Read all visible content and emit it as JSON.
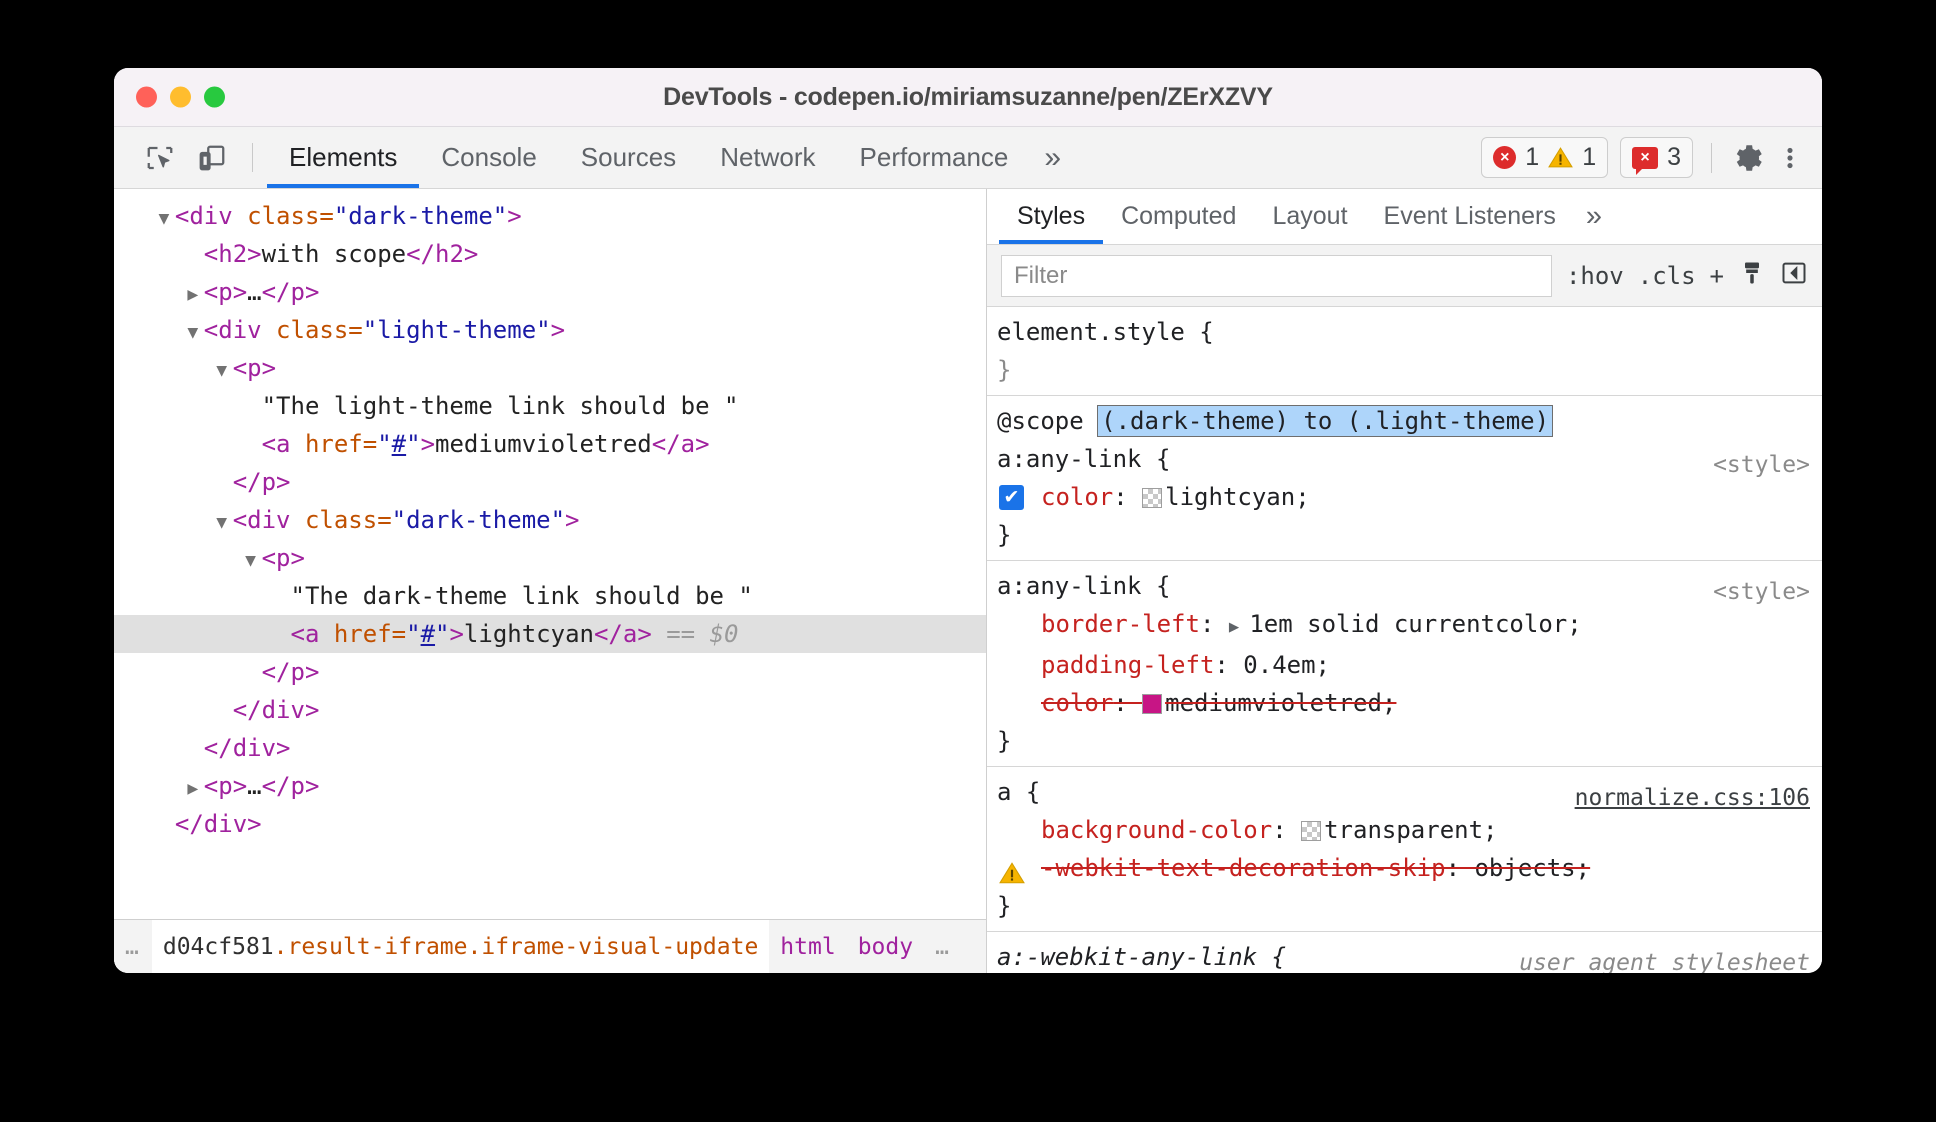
{
  "window": {
    "title": "DevTools - codepen.io/miriamsuzanne/pen/ZErXZVY"
  },
  "toolbar": {
    "icons": [
      {
        "name": "inspect-element-icon",
        "label": "Inspect element"
      },
      {
        "name": "device-toolbar-icon",
        "label": "Toggle device toolbar"
      }
    ],
    "tabs": [
      {
        "label": "Elements",
        "active": true
      },
      {
        "label": "Console",
        "active": false
      },
      {
        "label": "Sources",
        "active": false
      },
      {
        "label": "Network",
        "active": false
      },
      {
        "label": "Performance",
        "active": false
      }
    ],
    "more_tabs": "»",
    "badges": {
      "errors": "1",
      "warnings": "1",
      "issues": "3",
      "error_glyph": "×",
      "warning_glyph": "!",
      "issue_glyph": "×"
    },
    "settings_label": "Settings",
    "menu_label": "Customize and control DevTools"
  },
  "dom_tree": {
    "nodes": [
      {
        "twisty": "open",
        "indent": 1,
        "parts": [
          {
            "t": "tag",
            "s": "<div "
          },
          {
            "t": "attr",
            "s": "class="
          },
          {
            "t": "val",
            "s": "\"dark-theme\""
          },
          {
            "t": "tag",
            "s": ">"
          }
        ],
        "selected": false
      },
      {
        "twisty": "none",
        "indent": 2,
        "parts": [
          {
            "t": "tag",
            "s": "<h2>"
          },
          {
            "t": "txt",
            "s": "with scope"
          },
          {
            "t": "tag",
            "s": "</h2>"
          }
        ],
        "selected": false
      },
      {
        "twisty": "closed",
        "indent": 2,
        "parts": [
          {
            "t": "tag",
            "s": "<p>"
          },
          {
            "t": "txt",
            "s": "…"
          },
          {
            "t": "tag",
            "s": "</p>"
          }
        ],
        "selected": false
      },
      {
        "twisty": "open",
        "indent": 2,
        "parts": [
          {
            "t": "tag",
            "s": "<div "
          },
          {
            "t": "attr",
            "s": "class="
          },
          {
            "t": "val",
            "s": "\"light-theme\""
          },
          {
            "t": "tag",
            "s": ">"
          }
        ],
        "selected": false
      },
      {
        "twisty": "open",
        "indent": 3,
        "parts": [
          {
            "t": "tag",
            "s": "<p>"
          }
        ],
        "selected": false
      },
      {
        "twisty": "none",
        "indent": 4,
        "parts": [
          {
            "t": "txt",
            "s": "\"The light-theme link should be \""
          }
        ],
        "selected": false
      },
      {
        "twisty": "none",
        "indent": 4,
        "parts": [
          {
            "t": "tag",
            "s": "<a "
          },
          {
            "t": "attr",
            "s": "href="
          },
          {
            "t": "val",
            "s": "\""
          },
          {
            "t": "lnk",
            "s": "#"
          },
          {
            "t": "val",
            "s": "\""
          },
          {
            "t": "tag",
            "s": ">"
          },
          {
            "t": "txt",
            "s": "mediumvioletred"
          },
          {
            "t": "tag",
            "s": "</a>"
          }
        ],
        "selected": false
      },
      {
        "twisty": "none",
        "indent": 3,
        "parts": [
          {
            "t": "tag",
            "s": "</p>"
          }
        ],
        "selected": false
      },
      {
        "twisty": "open",
        "indent": 3,
        "parts": [
          {
            "t": "tag",
            "s": "<div "
          },
          {
            "t": "attr",
            "s": "class="
          },
          {
            "t": "val",
            "s": "\"dark-theme\""
          },
          {
            "t": "tag",
            "s": ">"
          }
        ],
        "selected": false
      },
      {
        "twisty": "open",
        "indent": 4,
        "parts": [
          {
            "t": "tag",
            "s": "<p>"
          }
        ],
        "selected": false
      },
      {
        "twisty": "none",
        "indent": 5,
        "parts": [
          {
            "t": "txt",
            "s": "\"The dark-theme link should be \""
          }
        ],
        "selected": false
      },
      {
        "twisty": "none",
        "indent": 5,
        "parts": [
          {
            "t": "tag",
            "s": "<a "
          },
          {
            "t": "attr",
            "s": "href="
          },
          {
            "t": "val",
            "s": "\""
          },
          {
            "t": "lnk",
            "s": "#"
          },
          {
            "t": "val",
            "s": "\""
          },
          {
            "t": "tag",
            "s": ">"
          },
          {
            "t": "txt",
            "s": "lightcyan"
          },
          {
            "t": "tag",
            "s": "</a>"
          },
          {
            "t": "dollar",
            "s": " == $0"
          }
        ],
        "selected": true
      },
      {
        "twisty": "none",
        "indent": 4,
        "parts": [
          {
            "t": "tag",
            "s": "</p>"
          }
        ],
        "selected": false
      },
      {
        "twisty": "none",
        "indent": 3,
        "parts": [
          {
            "t": "tag",
            "s": "</div>"
          }
        ],
        "selected": false
      },
      {
        "twisty": "none",
        "indent": 2,
        "parts": [
          {
            "t": "tag",
            "s": "</div>"
          }
        ],
        "selected": false
      },
      {
        "twisty": "closed",
        "indent": 2,
        "parts": [
          {
            "t": "tag",
            "s": "<p>"
          },
          {
            "t": "txt",
            "s": "…"
          },
          {
            "t": "tag",
            "s": "</p>"
          }
        ],
        "selected": false
      },
      {
        "twisty": "none",
        "indent": 1,
        "parts": [
          {
            "t": "tag",
            "s": "</div>"
          }
        ],
        "selected": false
      }
    ]
  },
  "breadcrumb": {
    "leading_ellipsis": "…",
    "trailing_ellipsis": "…",
    "items": [
      {
        "id": "d04cf581",
        "classes": ".result-iframe.iframe-visual-update",
        "tag": ""
      },
      {
        "id": "",
        "classes": "",
        "tag": "html"
      },
      {
        "id": "",
        "classes": "",
        "tag": "body"
      }
    ]
  },
  "styles_pane": {
    "tabs": [
      {
        "label": "Styles",
        "active": true
      },
      {
        "label": "Computed",
        "active": false
      },
      {
        "label": "Layout",
        "active": false
      },
      {
        "label": "Event Listeners",
        "active": false
      }
    ],
    "more_tabs": "»",
    "filter": {
      "placeholder": "Filter",
      "value": ""
    },
    "tools": {
      "hov": ":hov",
      "cls": ".cls",
      "new_rule": "+",
      "element_classes_icon": "paintbrush-icon",
      "sidebar_toggle_icon": "sidebar-toggle-icon"
    },
    "rules": [
      {
        "selector": "element.style {",
        "close": "}",
        "origin": "",
        "muted": true,
        "declarations": []
      },
      {
        "scope_prefix": "@scope ",
        "scope_value": "(.dark-theme) to (.light-theme)",
        "selector": "a:any-link {",
        "close": "}",
        "origin": "<style>",
        "origin_kind": "plain",
        "declarations": [
          {
            "checkbox": true,
            "checked": true,
            "name": "color",
            "value": "lightcyan",
            "swatch": "checker",
            "struck": false
          }
        ]
      },
      {
        "selector": "a:any-link {",
        "close": "}",
        "origin": "<style>",
        "origin_kind": "plain",
        "declarations": [
          {
            "checkbox": false,
            "name": "border-left",
            "value": "1em solid currentcolor",
            "expand_arrow": true,
            "struck": false
          },
          {
            "checkbox": false,
            "name": "padding-left",
            "value": "0.4em",
            "struck": false
          },
          {
            "checkbox": false,
            "name": "color",
            "value": "mediumvioletred",
            "swatch": "mvr",
            "swatch_color": "#c71585",
            "struck": true
          }
        ]
      },
      {
        "selector": "a {",
        "close": "}",
        "origin": "normalize.css:106",
        "origin_kind": "link",
        "declarations": [
          {
            "checkbox": false,
            "name": "background-color",
            "value": "transparent",
            "swatch": "checker",
            "struck": false
          },
          {
            "warning": true,
            "name": "-webkit-text-decoration-skip",
            "value": "objects",
            "struck": true
          }
        ]
      },
      {
        "selector": "a:-webkit-any-link {",
        "close": "",
        "origin": "user agent stylesheet",
        "origin_kind": "italic",
        "italic_selector": true,
        "declarations": []
      }
    ]
  },
  "colors": {
    "accent": "#1a73e8",
    "error": "#dd2c2c",
    "warning": "#f6b400",
    "property": "#c5221f",
    "tag": "#a0229e",
    "attribute": "#c05000",
    "attr_value": "#1a1aa6",
    "selection_highlight": "#aed5fa",
    "mediumvioletred": "#c71585"
  }
}
